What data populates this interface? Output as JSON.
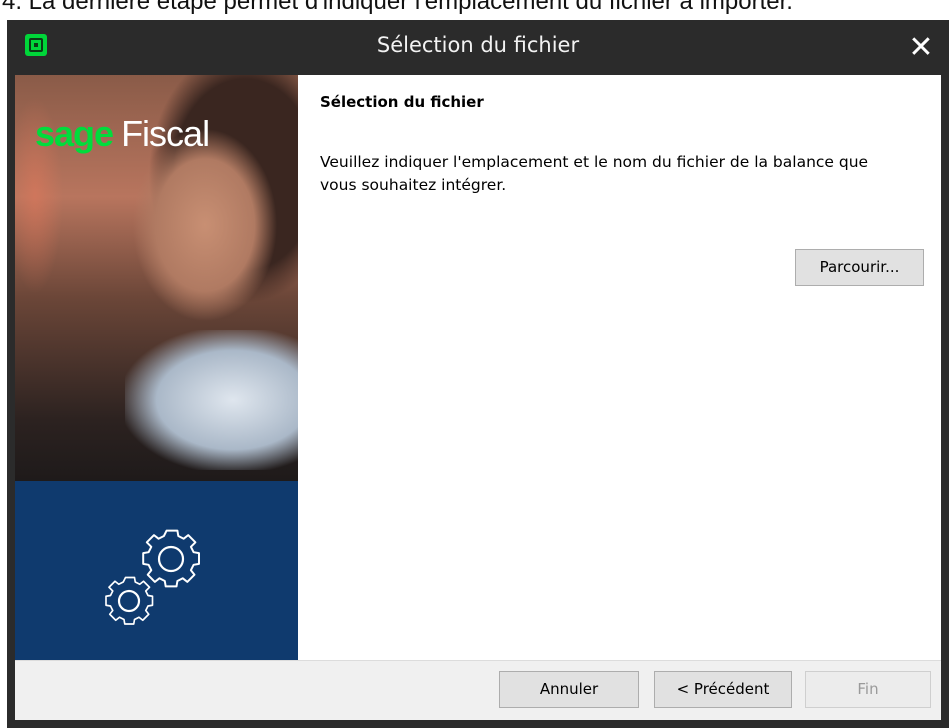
{
  "document": {
    "caption": "4. La dernière étape permet d'indiquer l'emplacement du fichier à importer."
  },
  "window": {
    "title": "Sélection du fichier",
    "close_glyph": "✕",
    "app_icon": "sage-app-icon"
  },
  "side_panel": {
    "brand_primary": "sage",
    "brand_secondary": "Fiscal",
    "brand_color": "#00dc3c",
    "band_color": "#0f3a6e",
    "icon": "gears-icon"
  },
  "content": {
    "heading": "Sélection du fichier",
    "instructions": "Veuillez indiquer l'emplacement et le nom du fichier de la balance que vous souhaitez intégrer.",
    "browse_label": "Parcourir..."
  },
  "footer": {
    "cancel_label": "Annuler",
    "previous_label": "< Précédent",
    "finish_label": "Fin",
    "finish_enabled": false
  }
}
